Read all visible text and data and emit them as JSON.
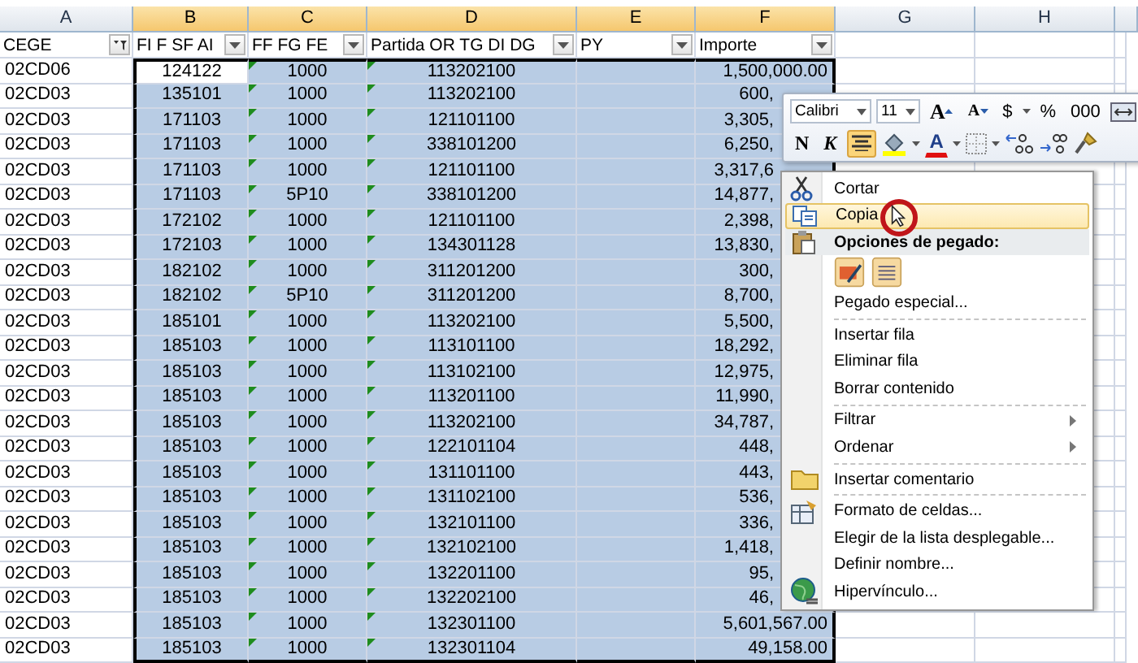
{
  "columns": [
    {
      "letter": "A",
      "selected": false
    },
    {
      "letter": "B",
      "selected": true
    },
    {
      "letter": "C",
      "selected": true
    },
    {
      "letter": "D",
      "selected": true
    },
    {
      "letter": "E",
      "selected": true
    },
    {
      "letter": "F",
      "selected": true
    },
    {
      "letter": "G",
      "selected": false
    },
    {
      "letter": "H",
      "selected": false
    }
  ],
  "header": [
    {
      "label": "CEGE",
      "filter_applied": true
    },
    {
      "label": "FI F SF AI",
      "filter_applied": false
    },
    {
      "label": "FF FG FE",
      "filter_applied": false
    },
    {
      "label": "Partida OR TG DI DG",
      "filter_applied": false
    },
    {
      "label": "PY",
      "filter_applied": false
    },
    {
      "label": "Importe",
      "filter_applied": false
    }
  ],
  "rows": [
    {
      "cege": "02CD06",
      "fi": "124122",
      "ff": "1000",
      "partida": "113202100",
      "importe": "1,500,000.00",
      "active": true
    },
    {
      "cege": "02CD03",
      "fi": "135101",
      "ff": "1000",
      "partida": "113202100",
      "importe": "600,",
      "active": false
    },
    {
      "cege": "02CD03",
      "fi": "171103",
      "ff": "1000",
      "partida": "121101100",
      "importe": "3,305,",
      "active": false
    },
    {
      "cege": "02CD03",
      "fi": "171103",
      "ff": "1000",
      "partida": "338101200",
      "importe": "6,250,",
      "active": false
    },
    {
      "cege": "02CD03",
      "fi": "171103",
      "ff": "1000",
      "partida": "121101100",
      "importe": "3,317,6",
      "active": false
    },
    {
      "cege": "02CD03",
      "fi": "171103",
      "ff": "5P10",
      "partida": "338101200",
      "importe": "14,877,",
      "active": false
    },
    {
      "cege": "02CD03",
      "fi": "172102",
      "ff": "1000",
      "partida": "121101100",
      "importe": "2,398,",
      "active": false
    },
    {
      "cege": "02CD03",
      "fi": "172103",
      "ff": "1000",
      "partida": "134301128",
      "importe": "13,830,",
      "active": false
    },
    {
      "cege": "02CD03",
      "fi": "182102",
      "ff": "1000",
      "partida": "311201200",
      "importe": "300,",
      "active": false
    },
    {
      "cege": "02CD03",
      "fi": "182102",
      "ff": "5P10",
      "partida": "311201200",
      "importe": "8,700,",
      "active": false
    },
    {
      "cege": "02CD03",
      "fi": "185101",
      "ff": "1000",
      "partida": "113202100",
      "importe": "5,500,",
      "active": false
    },
    {
      "cege": "02CD03",
      "fi": "185103",
      "ff": "1000",
      "partida": "113101100",
      "importe": "18,292,",
      "active": false
    },
    {
      "cege": "02CD03",
      "fi": "185103",
      "ff": "1000",
      "partida": "113102100",
      "importe": "12,975,",
      "active": false
    },
    {
      "cege": "02CD03",
      "fi": "185103",
      "ff": "1000",
      "partida": "113201100",
      "importe": "11,990,",
      "active": false
    },
    {
      "cege": "02CD03",
      "fi": "185103",
      "ff": "1000",
      "partida": "113202100",
      "importe": "34,787,",
      "active": false
    },
    {
      "cege": "02CD03",
      "fi": "185103",
      "ff": "1000",
      "partida": "122101104",
      "importe": "448,",
      "active": false
    },
    {
      "cege": "02CD03",
      "fi": "185103",
      "ff": "1000",
      "partida": "131101100",
      "importe": "443,",
      "active": false
    },
    {
      "cege": "02CD03",
      "fi": "185103",
      "ff": "1000",
      "partida": "131102100",
      "importe": "536,",
      "active": false
    },
    {
      "cege": "02CD03",
      "fi": "185103",
      "ff": "1000",
      "partida": "132101100",
      "importe": "336,",
      "active": false
    },
    {
      "cege": "02CD03",
      "fi": "185103",
      "ff": "1000",
      "partida": "132102100",
      "importe": "1,418,",
      "active": false
    },
    {
      "cege": "02CD03",
      "fi": "185103",
      "ff": "1000",
      "partida": "132201100",
      "importe": "95,",
      "active": false
    },
    {
      "cege": "02CD03",
      "fi": "185103",
      "ff": "1000",
      "partida": "132202100",
      "importe": "46,",
      "active": false
    },
    {
      "cege": "02CD03",
      "fi": "185103",
      "ff": "1000",
      "partida": "132301100",
      "importe": "5,601,567.00",
      "active": false
    },
    {
      "cege": "02CD03",
      "fi": "185103",
      "ff": "1000",
      "partida": "132301104",
      "importe": "49,158.00",
      "active": false
    }
  ],
  "mini_toolbar": {
    "top_controls": [
      {
        "kind": "combo",
        "label": "Calibri"
      },
      {
        "kind": "combo",
        "label": "11"
      },
      {
        "kind": "grow",
        "label": "A"
      },
      {
        "kind": "shrink",
        "label": "A"
      },
      {
        "kind": "text",
        "label": "$"
      },
      {
        "kind": "caret"
      },
      {
        "kind": "text",
        "label": "%"
      },
      {
        "kind": "text",
        "label": "000"
      },
      {
        "kind": "merge"
      }
    ],
    "bottom_controls": [
      {
        "kind": "bold",
        "label": "N",
        "on": false
      },
      {
        "kind": "italic",
        "label": "K",
        "on": false
      },
      {
        "kind": "align",
        "on": true
      },
      {
        "kind": "fill"
      },
      {
        "kind": "caret"
      },
      {
        "kind": "font-color",
        "label": "A"
      },
      {
        "kind": "caret"
      },
      {
        "kind": "borders"
      },
      {
        "kind": "caret"
      },
      {
        "kind": "inc-decimals"
      },
      {
        "kind": "dec-decimals"
      },
      {
        "kind": "painter"
      }
    ]
  },
  "context_menu": {
    "items": [
      {
        "kind": "cut",
        "label": "Cortar",
        "selected": false
      },
      {
        "kind": "copy",
        "label": "Copia",
        "selected": true
      },
      {
        "kind": "paste-header",
        "label": "Opciones de pegado:"
      },
      {
        "kind": "paste-options"
      },
      {
        "kind": "item",
        "label": "Pegado especial...",
        "selected": false
      },
      {
        "kind": "separator"
      },
      {
        "kind": "item",
        "label": "Insertar fila",
        "selected": false
      },
      {
        "kind": "item",
        "label": "Eliminar fila",
        "selected": false
      },
      {
        "kind": "item",
        "label": "Borrar contenido",
        "selected": false
      },
      {
        "kind": "separator"
      },
      {
        "kind": "submenu",
        "label": "Filtrar",
        "selected": false
      },
      {
        "kind": "submenu",
        "label": "Ordenar",
        "selected": false
      },
      {
        "kind": "separator"
      },
      {
        "kind": "comment",
        "label": "Insertar comentario",
        "selected": false
      },
      {
        "kind": "separator"
      },
      {
        "kind": "format",
        "label": "Formato de celdas...",
        "selected": false
      },
      {
        "kind": "item",
        "label": "Elegir de la lista desplegable...",
        "selected": false
      },
      {
        "kind": "item",
        "label": "Definir nombre...",
        "selected": false
      },
      {
        "kind": "link",
        "label": "Hipervínculo...",
        "selected": false
      }
    ]
  }
}
